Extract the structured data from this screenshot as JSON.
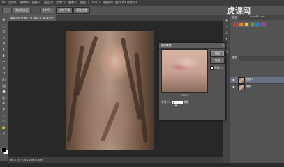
{
  "menubar": {
    "items": [
      "PS",
      "文件(F)",
      "编辑(E)",
      "图像(I)",
      "图层(L)",
      "文字(Y)",
      "选择(S)",
      "滤镜(T)",
      "3D(D)",
      "视图(V)",
      "窗口(W)",
      "帮助(H)"
    ]
  },
  "options": {
    "mode_label": "添加到选区",
    "feather_value": "100%",
    "smooth_label": "边缘平滑",
    "refine_label": "调整边缘"
  },
  "document": {
    "tab_label": "原图.jpg @ 66.7% (图层 1, RGB/8) *",
    "status_text": "66.67%    文档:2.25M/4.50M"
  },
  "panels": {
    "swatches_header": "颜色",
    "layers_header": "图层",
    "layers": [
      {
        "name": "图层 1"
      },
      {
        "name": "背景"
      }
    ]
  },
  "watermark": {
    "brand": "虎课网",
    "sub": "huke88.com"
  },
  "dialog": {
    "title": "高斯模糊",
    "close_glyph": "×",
    "ok_label": "确定",
    "cancel_label": "取消",
    "preview_label": "预览(P)",
    "zoom_out": "−",
    "zoom_value": "100%",
    "zoom_in": "+",
    "radius_label": "半径(R):",
    "radius_value": "6",
    "radius_unit": "像素",
    "slider_fraction": 0.3
  },
  "icons": {
    "toolbar": [
      "move-icon",
      "marquee-icon",
      "lasso-icon",
      "quick-select-icon",
      "crop-icon",
      "eyedropper-icon",
      "healing-icon",
      "brush-icon",
      "stamp-icon",
      "history-brush-icon",
      "eraser-icon",
      "gradient-icon",
      "blur-icon",
      "dodge-icon",
      "pen-icon",
      "type-icon",
      "path-select-icon",
      "shape-icon",
      "hand-icon",
      "zoom-icon"
    ],
    "dock": [
      "history-icon",
      "brush-settings-icon",
      "character-icon",
      "paragraph-icon",
      "info-icon",
      "properties-icon"
    ]
  },
  "colors": {
    "app_bg": "#2b2b2b",
    "panel": "#535353",
    "dialog": "#535353",
    "foreground": "#000000",
    "background": "#ffffff"
  }
}
